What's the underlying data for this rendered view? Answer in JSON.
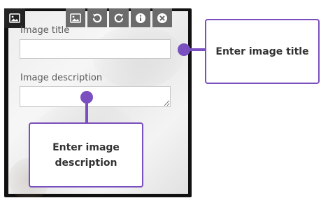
{
  "form": {
    "title_label": "Image title",
    "title_value": "",
    "title_placeholder": "",
    "description_label": "Image description",
    "description_value": "",
    "description_placeholder": ""
  },
  "toolbar": {
    "icons": [
      "image-icon",
      "rotate-left-icon",
      "rotate-right-icon",
      "info-icon",
      "close-icon"
    ]
  },
  "badge": {
    "icon": "image-icon"
  },
  "callouts": {
    "title_hint": "Enter image title",
    "description_hint": "Enter image description"
  },
  "colors": {
    "accent": "#7a4fbf",
    "toolbar": "#6b6b6b",
    "badge": "#232323"
  }
}
